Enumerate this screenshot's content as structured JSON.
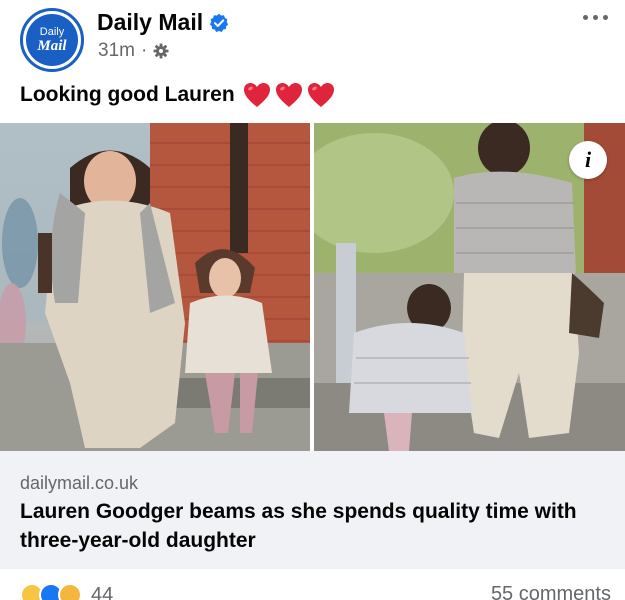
{
  "post": {
    "page_name": "Daily Mail",
    "avatar_text_line1": "Daily",
    "avatar_text_line2": "Mail",
    "timestamp": "31m",
    "separator": "·",
    "caption": "Looking good Lauren",
    "caption_emojis": [
      "heart-icon",
      "heart-icon",
      "heart-icon"
    ]
  },
  "link_preview": {
    "domain": "dailymail.co.uk",
    "title": "Lauren Goodger beams as she spends quality time with three-year-old daughter"
  },
  "engagement": {
    "reactions": [
      "haha",
      "like",
      "care"
    ],
    "reaction_count": "44",
    "comments": "55 comments"
  },
  "colors": {
    "brand_blue": "#1a5fc4",
    "verified_blue": "#1877f2",
    "heart_red": "#e0243b",
    "secondary_text": "#65676b",
    "card_bg": "#f0f2f5"
  },
  "icons": {
    "verified": "verified-badge-icon",
    "audience": "gear-icon",
    "menu": "more-horizontal-icon",
    "info": "info-icon"
  }
}
